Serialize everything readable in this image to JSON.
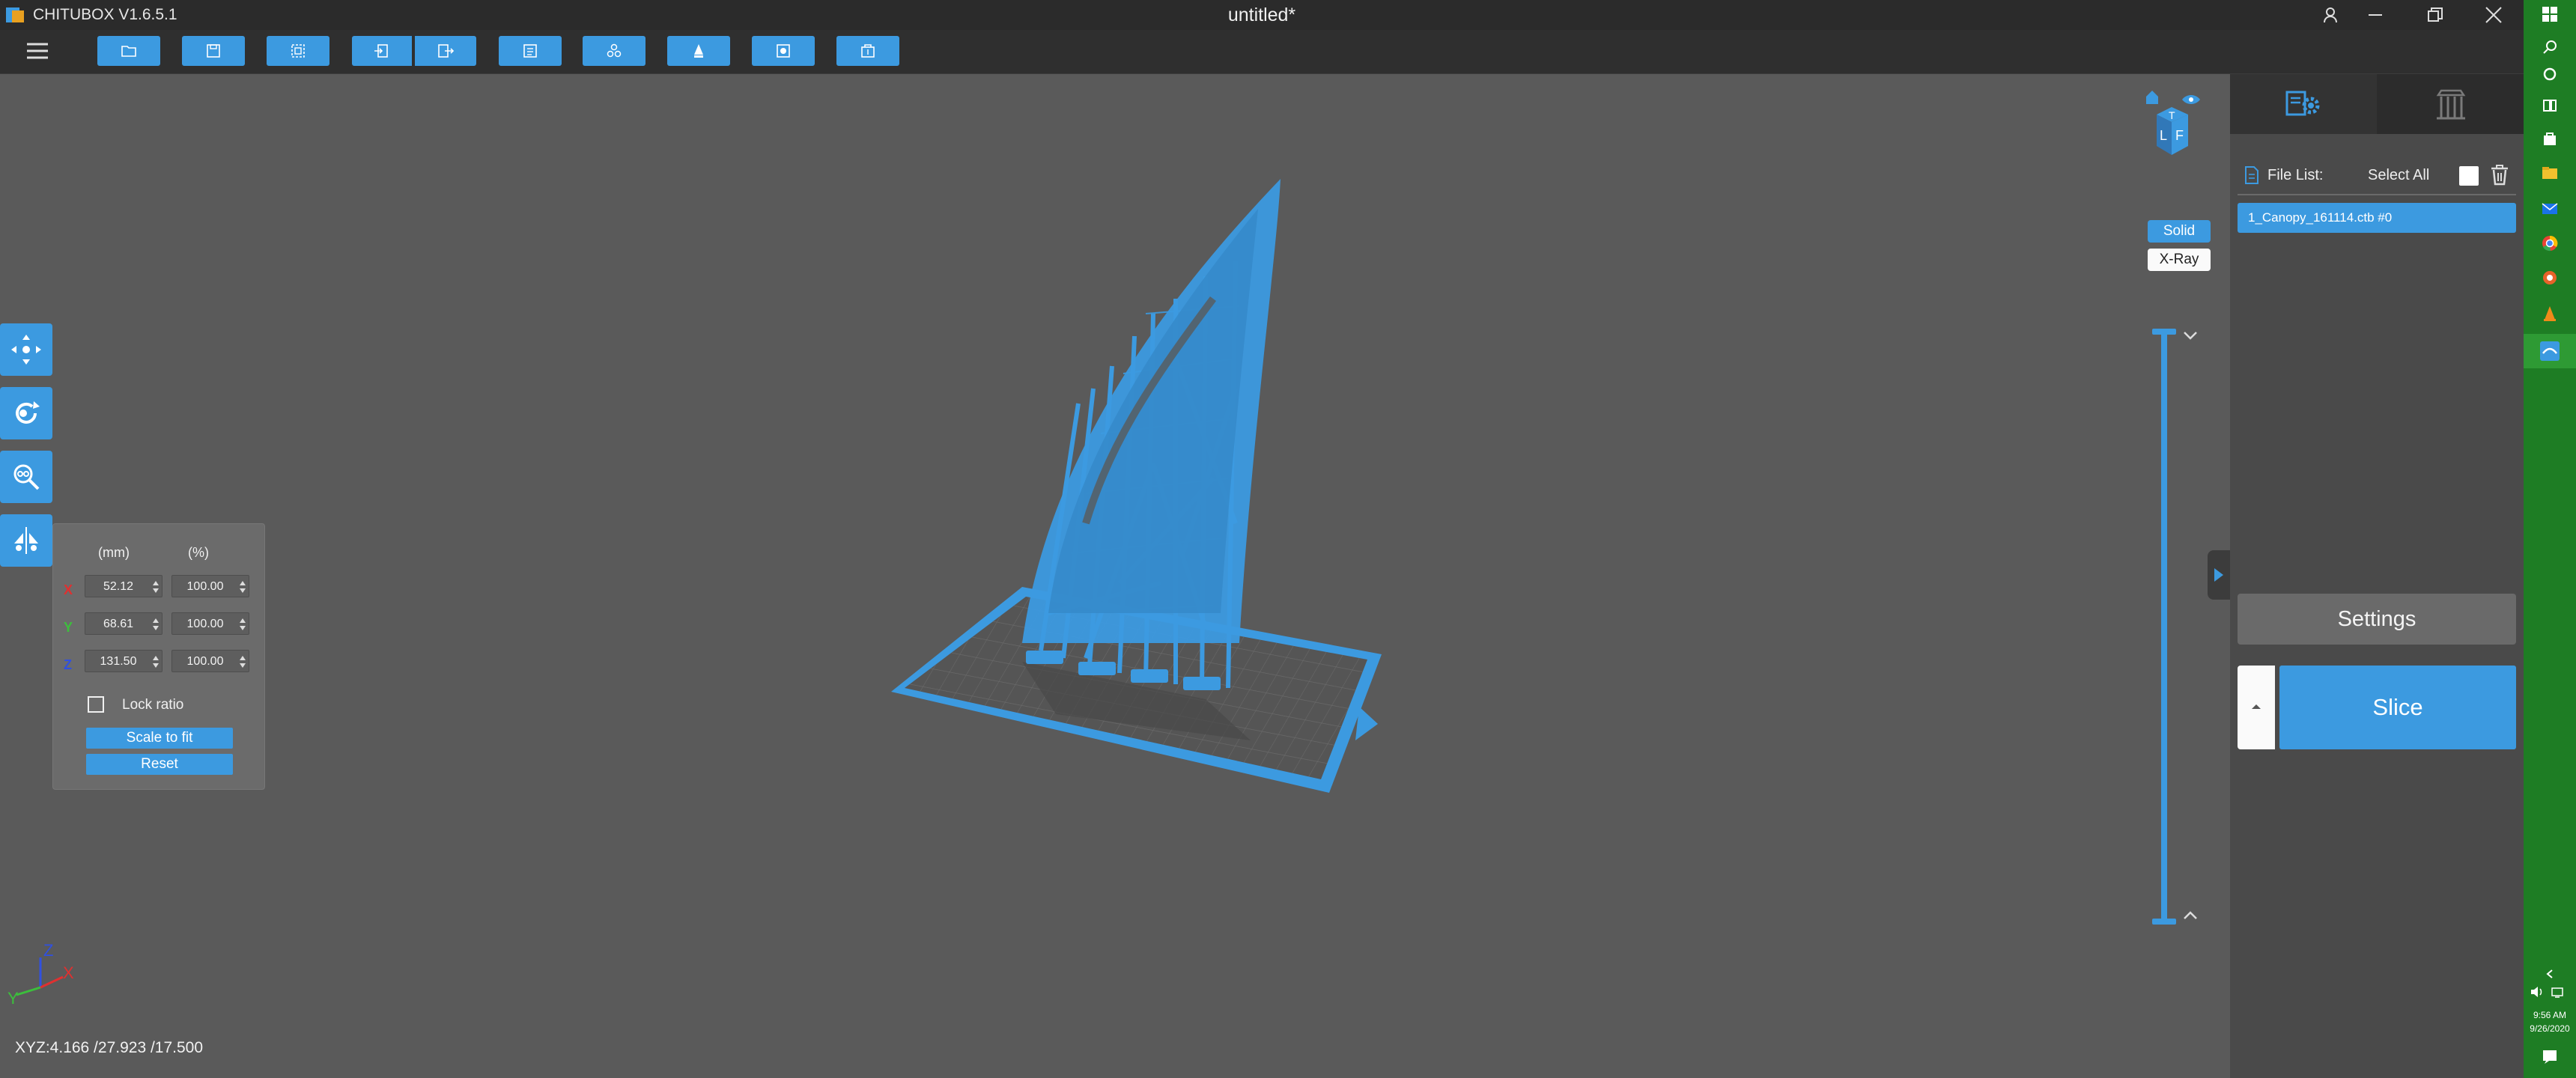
{
  "app": {
    "title": "CHITUBOX V1.6.5.1",
    "document_title": "untitled*"
  },
  "window_controls": [
    "account-icon",
    "minimize-icon",
    "restore-icon",
    "close-icon"
  ],
  "toolbar": {
    "items": [
      "open-file-icon",
      "save-icon",
      "screenshot-icon",
      "import-icon",
      "export-icon",
      "layout-icon",
      "auto-arrange-icon",
      "hollow-icon",
      "add-hole-icon",
      "support-icon"
    ]
  },
  "left_tools": [
    "move-icon",
    "rotate-icon",
    "scale-icon",
    "mirror-icon"
  ],
  "scale_panel": {
    "unit_mm": "(mm)",
    "unit_pct": "(%)",
    "axes": [
      {
        "axis": "X",
        "mm": "52.12",
        "pct": "100.00",
        "color": "#e03030"
      },
      {
        "axis": "Y",
        "mm": "68.61",
        "pct": "100.00",
        "color": "#3cbf3c"
      },
      {
        "axis": "Z",
        "mm": "131.50",
        "pct": "100.00",
        "color": "#3050e0"
      }
    ],
    "lock_ratio_label": "Lock ratio",
    "lock_ratio_checked": false,
    "scale_to_fit_label": "Scale to fit",
    "reset_label": "Reset"
  },
  "coords_readout": "XYZ:4.166 /27.923 /17.500",
  "axis_gizmo": {
    "z": "Z",
    "y": "Y",
    "x": "X"
  },
  "view_cube": {
    "labels": [
      "T",
      "L",
      "F"
    ]
  },
  "view_modes": {
    "solid": "Solid",
    "xray": "X-Ray",
    "active": "solid"
  },
  "right_panel": {
    "tabs": [
      "model-settings-icon",
      "support-tab-icon"
    ],
    "file_list_label": "File List:",
    "select_all_label": "Select All",
    "files": [
      "1_Canopy_161114.ctb #0"
    ],
    "settings_label": "Settings",
    "slice_label": "Slice"
  },
  "taskbar": {
    "icons": [
      "windows-icon",
      "search-icon",
      "cortana-icon",
      "task-view-icon",
      "store-icon",
      "file-explorer-icon",
      "mail-icon",
      "chrome-icon",
      "app-icon",
      "vlc-icon",
      "chitubox-icon"
    ],
    "time": "9:56 AM",
    "date": "9/26/2020"
  },
  "colors": {
    "accent": "#3c9ae0",
    "background": "#5a5a5a",
    "taskbar": "#1e7d24"
  }
}
